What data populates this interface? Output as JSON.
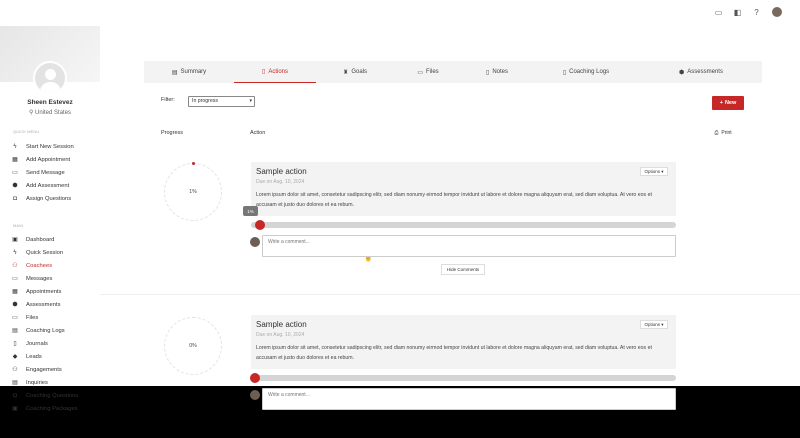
{
  "topbar": {
    "icons": [
      "chat-icon",
      "layers-icon",
      "help-icon"
    ]
  },
  "sidebar": {
    "name": "Sheen Estevez",
    "location": "United States",
    "quick_menu_label": "Quick Menu",
    "quick_menu": [
      {
        "label": "Start New Session",
        "icon": "bolt-icon"
      },
      {
        "label": "Add Appointment",
        "icon": "calendar-icon"
      },
      {
        "label": "Send Message",
        "icon": "message-icon"
      },
      {
        "label": "Add Assessment",
        "icon": "shield-icon"
      },
      {
        "label": "Assign Questions",
        "icon": "question-icon"
      }
    ],
    "main_label": "Main",
    "main_items": [
      {
        "label": "Dashboard",
        "icon": "dashboard-icon"
      },
      {
        "label": "Quick Session",
        "icon": "bolt-icon"
      },
      {
        "label": "Coachees",
        "icon": "users-icon"
      },
      {
        "label": "Messages",
        "icon": "message-icon"
      },
      {
        "label": "Appointments",
        "icon": "calendar-icon"
      },
      {
        "label": "Assessments",
        "icon": "shield-icon"
      },
      {
        "label": "Files",
        "icon": "folder-icon"
      },
      {
        "label": "Coaching Logs",
        "icon": "log-icon"
      },
      {
        "label": "Journals",
        "icon": "book-icon"
      },
      {
        "label": "Leads",
        "icon": "lead-icon"
      },
      {
        "label": "Engagements",
        "icon": "group-icon"
      },
      {
        "label": "Inquiries",
        "icon": "inbox-icon"
      },
      {
        "label": "Coaching Questions",
        "icon": "question-icon"
      },
      {
        "label": "Coaching Packages",
        "icon": "package-icon"
      }
    ],
    "active_item": "Coachees"
  },
  "tabs": [
    {
      "label": "Summary",
      "icon": "summary-icon"
    },
    {
      "label": "Actions",
      "icon": "clipboard-icon"
    },
    {
      "label": "Goals",
      "icon": "trophy-icon"
    },
    {
      "label": "Files",
      "icon": "folder-icon"
    },
    {
      "label": "Notes",
      "icon": "note-icon"
    },
    {
      "label": "Coaching Logs",
      "icon": "log-icon"
    },
    {
      "label": "Assessments",
      "icon": "shield-icon"
    }
  ],
  "active_tab": "Actions",
  "filter": {
    "label": "Filter:",
    "selected": "In progress"
  },
  "new_button": "New",
  "headers": {
    "progress": "Progress",
    "action": "Action",
    "print": "Print"
  },
  "actions": [
    {
      "progress_label": "1%",
      "progress": 0.01,
      "title": "Sample action",
      "due": "Due on Aug. 10, 2024",
      "description": "Lorem ipsum dolor sit amet, consetetur sadipscing elitr, sed diam nonumy eirmod tempor invidunt ut labore et dolore magna aliquyam erat, sed diam voluptua. At vero eos et accusam et justo duo dolores et ea rebum.",
      "options": "Options",
      "slider_tooltip": "1%",
      "comment_placeholder": "Write a comment...",
      "hide_comments": "Hide Comments"
    },
    {
      "progress_label": "0%",
      "progress": 0.0,
      "title": "Sample action",
      "due": "Due on Aug. 10, 2024",
      "description": "Lorem ipsum dolor sit amet, consetetur sadipscing elitr, sed diam nonumy eirmod tempor invidunt ut labore et dolore magna aliquyam erat, sed diam voluptua. At vero eos et accusam et justo duo dolores et ea rebum.",
      "options": "Options",
      "comment_placeholder": "Write a comment..."
    }
  ],
  "colors": {
    "accent": "#c62828",
    "tab_bg": "#f3f3f3",
    "card_bg": "#f3f3f3"
  }
}
